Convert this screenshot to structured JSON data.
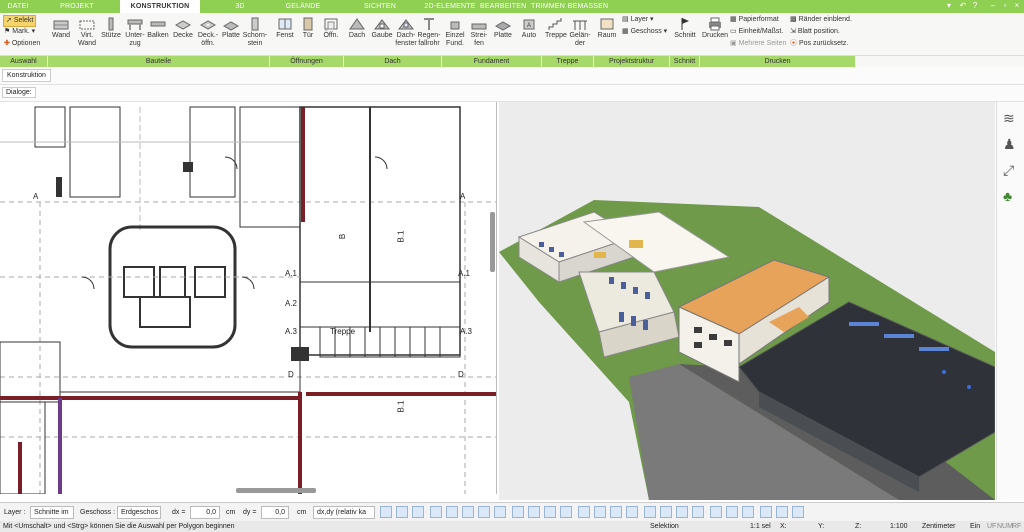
{
  "tabs": [
    "DATEI",
    "PROJEKT",
    "KONSTRUKTION",
    "3D",
    "GELÄNDE",
    "SICHTEN",
    "2D-ELEMENTE",
    "BEARBEITEN",
    "TRIMMEN",
    "BEMASSEN"
  ],
  "active_tab": "KONSTRUKTION",
  "ribbon": {
    "auswahl": {
      "select": "Selekt",
      "mark": "Mark.",
      "options": "Optionen"
    },
    "groups": [
      "Auswahl",
      "Bauteile",
      "Öffnungen",
      "Dach",
      "Fundament",
      "Treppe",
      "Projektstruktur",
      "Schnitt",
      "Drucken"
    ],
    "bauteile": [
      {
        "line1": "Wand",
        "line2": ""
      },
      {
        "line1": "Virt.",
        "line2": "Wand"
      },
      {
        "line1": "Stütze",
        "line2": ""
      },
      {
        "line1": "Unter-",
        "line2": "zug"
      },
      {
        "line1": "Balken",
        "line2": ""
      },
      {
        "line1": "Decke",
        "line2": ""
      },
      {
        "line1": "Deck.-",
        "line2": "öffn."
      },
      {
        "line1": "Platte",
        "line2": ""
      },
      {
        "line1": "Schorn-",
        "line2": "stein"
      }
    ],
    "oeffnungen": [
      {
        "line1": "Fenst",
        "line2": ""
      },
      {
        "line1": "Tür",
        "line2": ""
      },
      {
        "line1": "Öffn.",
        "line2": ""
      }
    ],
    "dach": [
      {
        "line1": "Dach",
        "line2": ""
      },
      {
        "line1": "Gaube",
        "line2": ""
      },
      {
        "line1": "Dach-",
        "line2": "fenster"
      },
      {
        "line1": "Regen-",
        "line2": "fallrohr"
      }
    ],
    "fundament": [
      {
        "line1": "Einzel",
        "line2": "Fund."
      },
      {
        "line1": "Strei-",
        "line2": "fen"
      },
      {
        "line1": "Platte",
        "line2": ""
      },
      {
        "line1": "Auto",
        "line2": ""
      }
    ],
    "treppe": [
      {
        "line1": "Treppe",
        "line2": ""
      },
      {
        "line1": "Gelän-",
        "line2": "der"
      }
    ],
    "projektstruktur": {
      "raum": "Raum",
      "layer": "Layer",
      "geschoss": "Geschoss"
    },
    "schnitt": "Schnitt",
    "drucken": {
      "main": "Drucken",
      "papierformat": "Papierformat",
      "einheit": "Einheit/Maßst.",
      "mehrere": "Mehrere Seiten",
      "raender": "Ränder einblend.",
      "blatt": "Blatt position.",
      "pos": "Pos zurücksetz."
    }
  },
  "strip1_button": "Konstruktion",
  "strip2_label": "Dialoge:",
  "plan_labels": {
    "treppe": "Treppe",
    "a": "A",
    "a1": "A.1",
    "a2": "A.2",
    "a3": "A.3",
    "b": "B",
    "b1": "B.1",
    "d": "D"
  },
  "options_bar": {
    "layer_label": "Layer :",
    "layer_value": "Schnitte im",
    "geschoss_label": "Geschoss :",
    "geschoss_value": "Erdgeschos",
    "dx_label": "dx =",
    "dx_value": "0,0",
    "dx_unit": "cm",
    "dy_label": "dy =",
    "dy_value": "0,0",
    "dy_unit": "cm",
    "mode_value": "dx,dy (relativ ka"
  },
  "status": {
    "hint": "Mit <Umschalt> und <Strg> können Sie die Auswahl per Polygon beginnen",
    "mode": "Selektion",
    "sel": "1:1 sel",
    "x": "X:",
    "y": "Y:",
    "z": "Z:",
    "scale": "1:100",
    "unit": "Zentimeter",
    "ein": "Ein",
    "uf": "UF",
    "num": "NUM",
    "rf": "RF"
  },
  "colors": {
    "accent_green": "#8fcf52",
    "group_green": "#a6d96a",
    "wall_dark_red": "#7a1f28"
  }
}
